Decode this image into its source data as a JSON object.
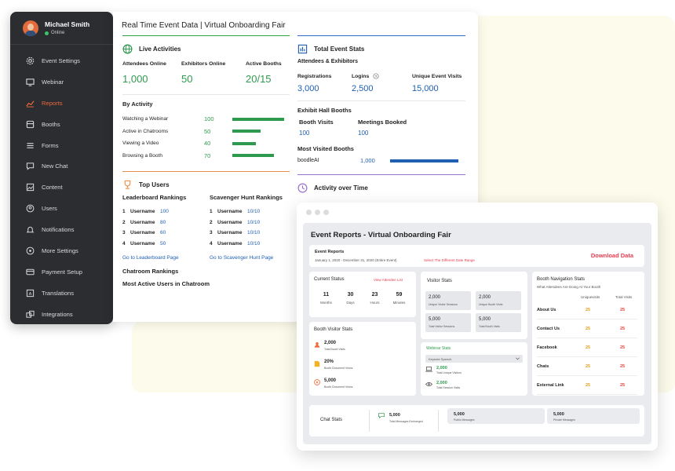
{
  "sidebar": {
    "user_name": "Michael Smith",
    "user_status": "Online",
    "items": [
      {
        "label": "Event Settings",
        "icon": "gear-icon"
      },
      {
        "label": "Webinar",
        "icon": "monitor-icon"
      },
      {
        "label": "Reports",
        "icon": "chart-icon",
        "active": true
      },
      {
        "label": "Booths",
        "icon": "booth-icon"
      },
      {
        "label": "Forms",
        "icon": "form-icon"
      },
      {
        "label": "New Chat",
        "icon": "chat-icon"
      },
      {
        "label": "Content",
        "icon": "image-icon"
      },
      {
        "label": "Users",
        "icon": "user-icon"
      },
      {
        "label": "Notifications",
        "icon": "bell-icon"
      },
      {
        "label": "More Settings",
        "icon": "settings-icon"
      },
      {
        "label": "Payment Setup",
        "icon": "card-icon"
      },
      {
        "label": "Translations",
        "icon": "translate-icon"
      },
      {
        "label": "Integrations",
        "icon": "integrations-icon"
      }
    ]
  },
  "dashboard": {
    "title": "Real Time Event Data | Virtual Onboarding Fair",
    "live": {
      "heading": "Live Activities",
      "attendees_label": "Attendees Online",
      "attendees_value": "1,000",
      "exhibitors_label": "Exhibitors Online",
      "exhibitors_value": "50",
      "booths_label": "Active Booths",
      "booths_value": "20/15"
    },
    "by_activity": {
      "heading": "By Activity",
      "rows": [
        {
          "name": "Watching a Webinar",
          "value": "100",
          "fraction": 1.0
        },
        {
          "name": "Active in Chatrooms",
          "value": "50",
          "fraction": 0.55
        },
        {
          "name": "Viewing a Video",
          "value": "40",
          "fraction": 0.45
        },
        {
          "name": "Browsing a Booth",
          "value": "70",
          "fraction": 0.8
        }
      ]
    },
    "top_users": {
      "heading": "Top Users",
      "leaderboard_heading": "Leaderboard Rankings",
      "scavenger_heading": "Scavenger Hunt Rankings",
      "leaderboard": [
        {
          "rank": "1",
          "user": "Username",
          "score": "100"
        },
        {
          "rank": "2",
          "user": "Username",
          "score": "80"
        },
        {
          "rank": "3",
          "user": "Username",
          "score": "60"
        },
        {
          "rank": "4",
          "user": "Username",
          "score": "50"
        }
      ],
      "scavenger": [
        {
          "rank": "1",
          "user": "Username",
          "score": "10/10"
        },
        {
          "rank": "2",
          "user": "Username",
          "score": "10/10"
        },
        {
          "rank": "3",
          "user": "Username",
          "score": "10/10"
        },
        {
          "rank": "4",
          "user": "Username",
          "score": "10/10"
        }
      ],
      "leaderboard_link": "Go to Leaderboard Page",
      "scavenger_link": "Go to Scavenger Hunt Page",
      "chatroom_heading": "Chatroom Rankings",
      "most_active": "Most Active Users in Chatroom"
    },
    "total_stats": {
      "heading": "Total Event Stats",
      "sub": "Attendees & Exhibitors",
      "registrations_label": "Registrations",
      "registrations_value": "3,000",
      "logins_label": "Logins",
      "logins_value": "2,500",
      "unique_label": "Unique Event Visits",
      "unique_value": "15,000"
    },
    "exhibit": {
      "heading": "Exhibit Hall Booths",
      "booth_visits_label": "Booth Visits",
      "booth_visits_value": "100",
      "meetings_label": "Meetings Booked",
      "meetings_value": "100",
      "most_visited_heading": "Most Visited Booths",
      "booth_name": "boodleAI",
      "booth_value": "1,000"
    },
    "activity_time": {
      "heading": "Activity over Time"
    }
  },
  "reports": {
    "title": "Event Reports - Virtual Onboarding Fair",
    "event_reports_label": "Event Reports",
    "date_range": "January 1, 2020 - December 31, 2020 (Entire Event)",
    "select_range": "Select The Different Date Range",
    "download": "Download Data",
    "current_status": {
      "heading": "Current Status",
      "link": "View Attendee List",
      "items": [
        {
          "value": "11",
          "unit": "Months"
        },
        {
          "value": "30",
          "unit": "Days"
        },
        {
          "value": "23",
          "unit": "Hours"
        },
        {
          "value": "59",
          "unit": "Minutes"
        }
      ]
    },
    "visitor_stats": {
      "heading": "Visitor Stats",
      "boxes": [
        {
          "value": "2,000",
          "label": "Unique Visitor Sessions"
        },
        {
          "value": "2,000",
          "label": "Unique Booth Visits"
        },
        {
          "value": "5,000",
          "label": "Total Visitor Sessions"
        },
        {
          "value": "5,000",
          "label": "Total Booth Visits"
        }
      ]
    },
    "booth_nav": {
      "heading": "Booth Navigation Stats",
      "sub": "What Attendees Are Doing At Your Booth",
      "col1": "Uniquevisits",
      "col2": "Total Visits",
      "rows": [
        {
          "name": "About Us",
          "u": "25",
          "t": "25"
        },
        {
          "name": "Contact Us",
          "u": "25",
          "t": "25"
        },
        {
          "name": "Facebook",
          "u": "25",
          "t": "25"
        },
        {
          "name": "Chats",
          "u": "25",
          "t": "25"
        },
        {
          "name": "External Link",
          "u": "25",
          "t": "25"
        }
      ]
    },
    "booth_visitor": {
      "heading": "Booth Visitor Stats",
      "rows": [
        {
          "value": "2,000",
          "label": "Total Booth Visits"
        },
        {
          "value": "20%",
          "label": "Booth Document Views"
        },
        {
          "value": "5,000",
          "label": "Booth Document Views"
        }
      ]
    },
    "webinar": {
      "heading": "Webinar Stats",
      "select": "Keynote Speech",
      "rows": [
        {
          "value": "2,000",
          "label": "Total Unique Visitors"
        },
        {
          "value": "2,000",
          "label": "Total Session Visits"
        }
      ]
    },
    "chat_stats": {
      "heading": "Chat Stats",
      "items": [
        {
          "value": "5,000",
          "label": "Total Messages Exchanged"
        },
        {
          "value": "5,000",
          "label": "Public Messages"
        },
        {
          "value": "5,000",
          "label": "Private Messages"
        }
      ]
    }
  },
  "colors": {
    "green": "#2e9a4e",
    "blue": "#1e5fb4",
    "orange": "#f0683a",
    "sidebar_bg": "#2b2d31"
  }
}
